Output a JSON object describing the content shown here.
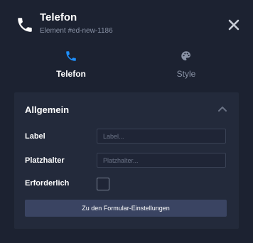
{
  "header": {
    "title": "Telefon",
    "subtitle": "Element #ed-new-1186",
    "icon": "phone-icon",
    "close_icon": "close-icon"
  },
  "tabs": [
    {
      "label": "Telefon",
      "icon": "phone-icon",
      "active": true
    },
    {
      "label": "Style",
      "icon": "palette-icon",
      "active": false
    }
  ],
  "panel": {
    "title": "Allgemein",
    "fields": {
      "label": {
        "label": "Label",
        "placeholder": "Label...",
        "value": ""
      },
      "placeholder": {
        "label": "Platzhalter",
        "placeholder": "Platzhalter...",
        "value": ""
      },
      "required": {
        "label": "Erforderlich",
        "checked": false
      }
    },
    "settings_button": "Zu den Formular-Einstellungen"
  },
  "colors": {
    "background": "#1c2231",
    "panel": "#232a3b",
    "accent": "#1e90ff",
    "muted": "#8a93a6",
    "button": "#3a4462"
  }
}
